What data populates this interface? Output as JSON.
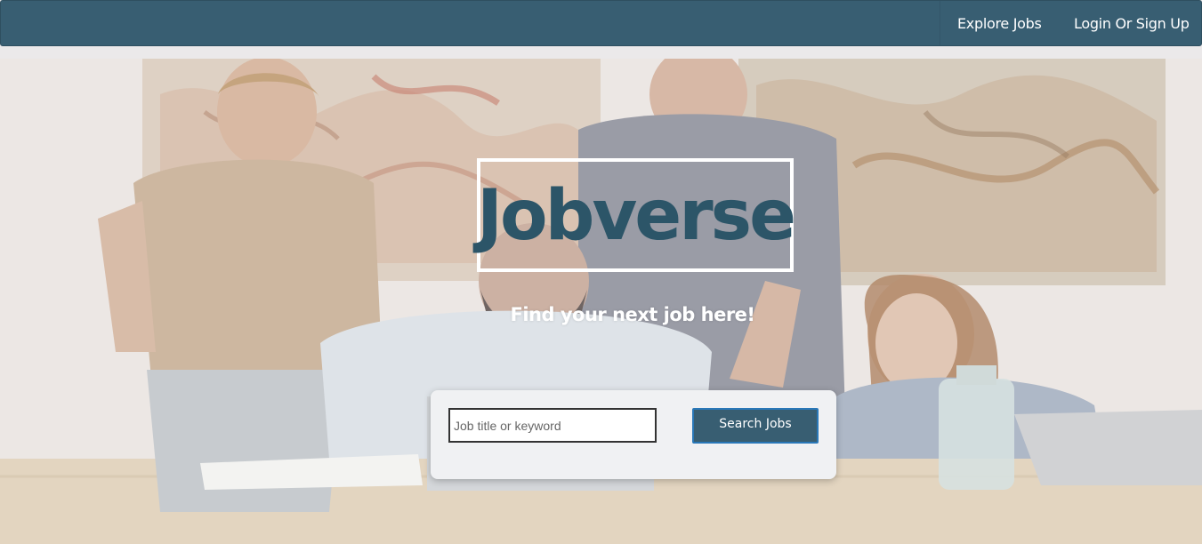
{
  "nav": {
    "explore_label": "Explore Jobs",
    "login_label": "Login Or Sign Up"
  },
  "hero": {
    "brand": "Jobverse",
    "tagline": "Find your next job here!"
  },
  "search": {
    "placeholder": "Job title or keyword",
    "value": "",
    "button_label": "Search Jobs"
  },
  "colors": {
    "primary": "#385e72",
    "brand_text": "#2c5568",
    "page_bg": "#ebe9ea",
    "card_bg": "#f0f1f3"
  }
}
